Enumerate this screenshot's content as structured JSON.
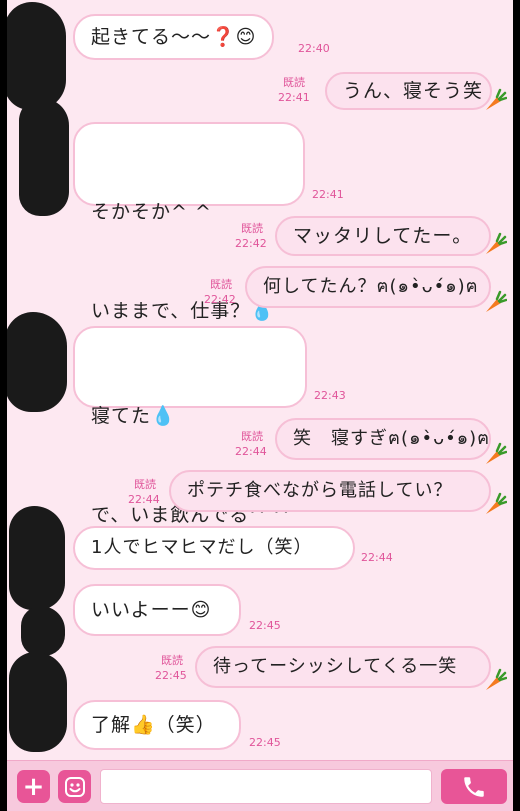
{
  "messages": [
    {
      "side": "left",
      "lines": [
        "起きてる〜〜❓😊"
      ],
      "time": "22:40"
    },
    {
      "side": "right",
      "lines": [
        "うん、寝そう笑"
      ],
      "read": "既読",
      "time": "22:41"
    },
    {
      "side": "left",
      "lines": [
        "そかそか^ ^",
        "いままで、仕事？💧"
      ],
      "time": "22:41"
    },
    {
      "side": "right",
      "lines": [
        "マッタリしてたー。"
      ],
      "read": "既読",
      "time": "22:42"
    },
    {
      "side": "right",
      "lines": [
        "何してたん？ฅ(๑•̀ᴗ•́๑)ฅ"
      ],
      "read": "既読",
      "time": "22:42"
    },
    {
      "side": "left",
      "lines": [
        "寝てた💧",
        "で、いま飲んでる^ ^"
      ],
      "time": "22:43"
    },
    {
      "side": "right",
      "lines": [
        "笑　寝すぎฅ(๑•̀ᴗ•́๑)ฅ"
      ],
      "read": "既読",
      "time": "22:44"
    },
    {
      "side": "right",
      "lines": [
        "ポテチ食べながら電話してい？"
      ],
      "read": "既読",
      "time": "22:44"
    },
    {
      "side": "left",
      "lines": [
        "1人でヒマヒマだし（笑）"
      ],
      "time": "22:44"
    },
    {
      "side": "left",
      "lines": [
        "いいよーー😊"
      ],
      "time": "22:45"
    },
    {
      "side": "right",
      "lines": [
        "待ってーシッシしてくる一笑"
      ],
      "read": "既読",
      "time": "22:45"
    },
    {
      "side": "left",
      "lines": [
        "了解👍（笑）"
      ],
      "time": "22:45"
    }
  ],
  "input_bar": {
    "add_icon": "plus-icon",
    "sticker_icon": "smiley-icon",
    "message_value": "",
    "call_icon": "phone-icon"
  },
  "colors": {
    "accent": "#e85597",
    "background": "#fde8f1",
    "bubble_border": "#f6bfd6",
    "time": "#e0559a"
  }
}
